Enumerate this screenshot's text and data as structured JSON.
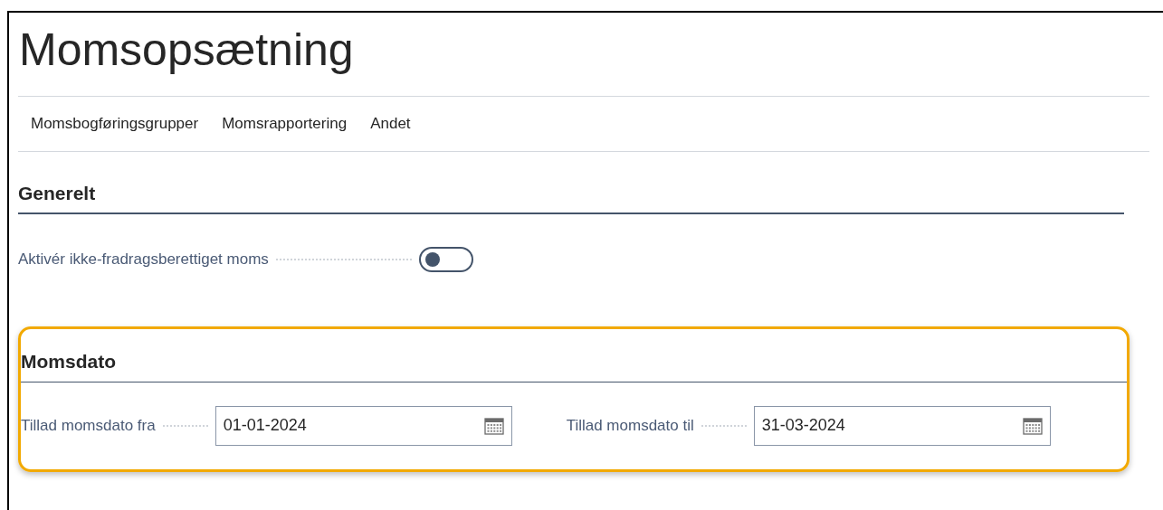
{
  "page": {
    "title": "Momsopsætning"
  },
  "actions": [
    "Momsbogføringsgrupper",
    "Momsrapportering",
    "Andet"
  ],
  "general": {
    "heading": "Generelt",
    "toggle": {
      "label": "Aktivér ikke-fradragsberettiget moms",
      "on": false
    }
  },
  "vat_date": {
    "heading": "Momsdato",
    "highlighted": true,
    "fields": [
      {
        "label": "Tillad momsdato fra",
        "value": "01-01-2024"
      },
      {
        "label": "Tillad momsdato til",
        "value": "31-03-2024"
      }
    ]
  }
}
